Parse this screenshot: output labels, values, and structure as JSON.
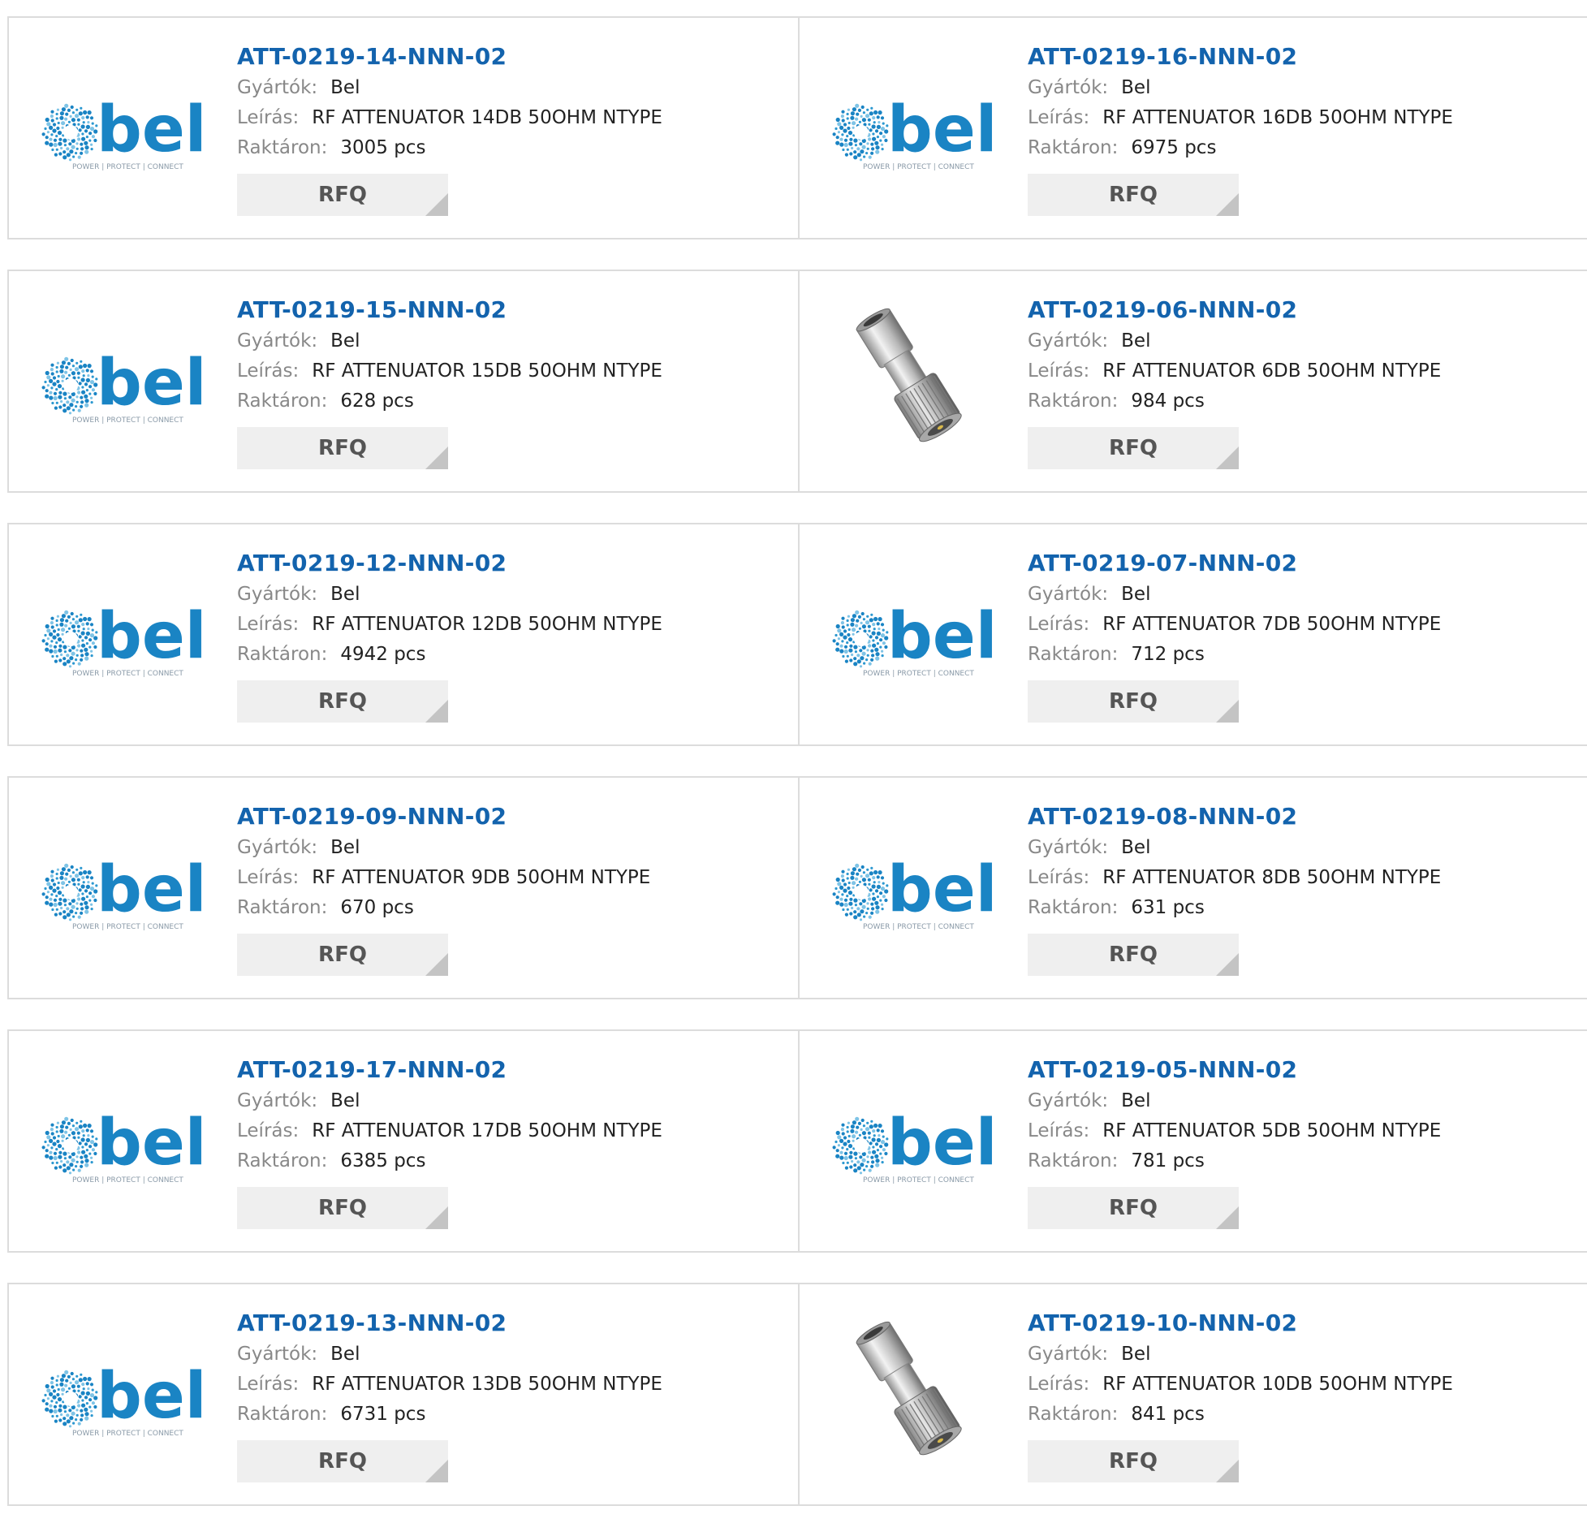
{
  "labels": {
    "manufacturer": "Gyártók:",
    "description": "Leírás:",
    "stock": "Raktáron:",
    "rfq": "RFQ"
  },
  "logo": {
    "word": "bel",
    "tagline": "POWER | PROTECT | CONNECT"
  },
  "colors": {
    "part_link": "#1363ad",
    "logo_blue": "#1a84c4",
    "rfq_bg": "#efefef"
  },
  "products": [
    {
      "part": "ATT-0219-14-NNN-02",
      "manufacturer": "Bel",
      "description": "RF ATTENUATOR 14DB 50OHM NTYPE",
      "stock": "3005 pcs",
      "image": "bel-logo"
    },
    {
      "part": "ATT-0219-16-NNN-02",
      "manufacturer": "Bel",
      "description": "RF ATTENUATOR 16DB 50OHM NTYPE",
      "stock": "6975 pcs",
      "image": "bel-logo"
    },
    {
      "part": "ATT-0219-15-NNN-02",
      "manufacturer": "Bel",
      "description": "RF ATTENUATOR 15DB 50OHM NTYPE",
      "stock": "628 pcs",
      "image": "bel-logo"
    },
    {
      "part": "ATT-0219-06-NNN-02",
      "manufacturer": "Bel",
      "description": "RF ATTENUATOR 6DB 50OHM NTYPE",
      "stock": "984 pcs",
      "image": "attenuator-photo"
    },
    {
      "part": "ATT-0219-12-NNN-02",
      "manufacturer": "Bel",
      "description": "RF ATTENUATOR 12DB 50OHM NTYPE",
      "stock": "4942 pcs",
      "image": "bel-logo"
    },
    {
      "part": "ATT-0219-07-NNN-02",
      "manufacturer": "Bel",
      "description": "RF ATTENUATOR 7DB 50OHM NTYPE",
      "stock": "712 pcs",
      "image": "bel-logo"
    },
    {
      "part": "ATT-0219-09-NNN-02",
      "manufacturer": "Bel",
      "description": "RF ATTENUATOR 9DB 50OHM NTYPE",
      "stock": "670 pcs",
      "image": "bel-logo"
    },
    {
      "part": "ATT-0219-08-NNN-02",
      "manufacturer": "Bel",
      "description": "RF ATTENUATOR 8DB 50OHM NTYPE",
      "stock": "631 pcs",
      "image": "bel-logo"
    },
    {
      "part": "ATT-0219-17-NNN-02",
      "manufacturer": "Bel",
      "description": "RF ATTENUATOR 17DB 50OHM NTYPE",
      "stock": "6385 pcs",
      "image": "bel-logo"
    },
    {
      "part": "ATT-0219-05-NNN-02",
      "manufacturer": "Bel",
      "description": "RF ATTENUATOR 5DB 50OHM NTYPE",
      "stock": "781 pcs",
      "image": "bel-logo"
    },
    {
      "part": "ATT-0219-13-NNN-02",
      "manufacturer": "Bel",
      "description": "RF ATTENUATOR 13DB 50OHM NTYPE",
      "stock": "6731 pcs",
      "image": "bel-logo"
    },
    {
      "part": "ATT-0219-10-NNN-02",
      "manufacturer": "Bel",
      "description": "RF ATTENUATOR 10DB 50OHM NTYPE",
      "stock": "841 pcs",
      "image": "attenuator-photo"
    }
  ]
}
